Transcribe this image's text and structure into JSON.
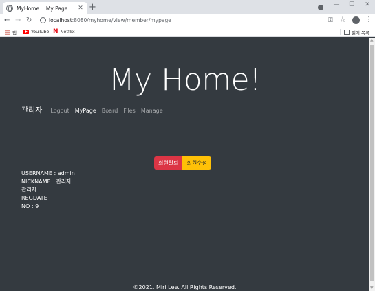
{
  "browser": {
    "tab_title": "MyHome :: My Page",
    "url_host": "localhost",
    "url_rest": ":8080/myhome/view/member/mypage",
    "bookmarks": {
      "apps": "앱",
      "youtube": "YouTube",
      "netflix": "Netflix",
      "reading_list": "읽기 목록"
    }
  },
  "site": {
    "hero_title": "My Home!",
    "brand": "관리자",
    "nav": [
      "Logout",
      "MyPage",
      "Board",
      "Files",
      "Manage"
    ]
  },
  "actions": {
    "withdraw_label": "회원탈퇴",
    "edit_label": "회원수정"
  },
  "profile": {
    "username": "USERNAME : admin",
    "nickname": "NICKNAME : 관리자",
    "role": "관리자",
    "regdate": "REGDATE :",
    "no": "NO : 9"
  },
  "footer": "©2021. Miri Lee. All Rights Reserved."
}
